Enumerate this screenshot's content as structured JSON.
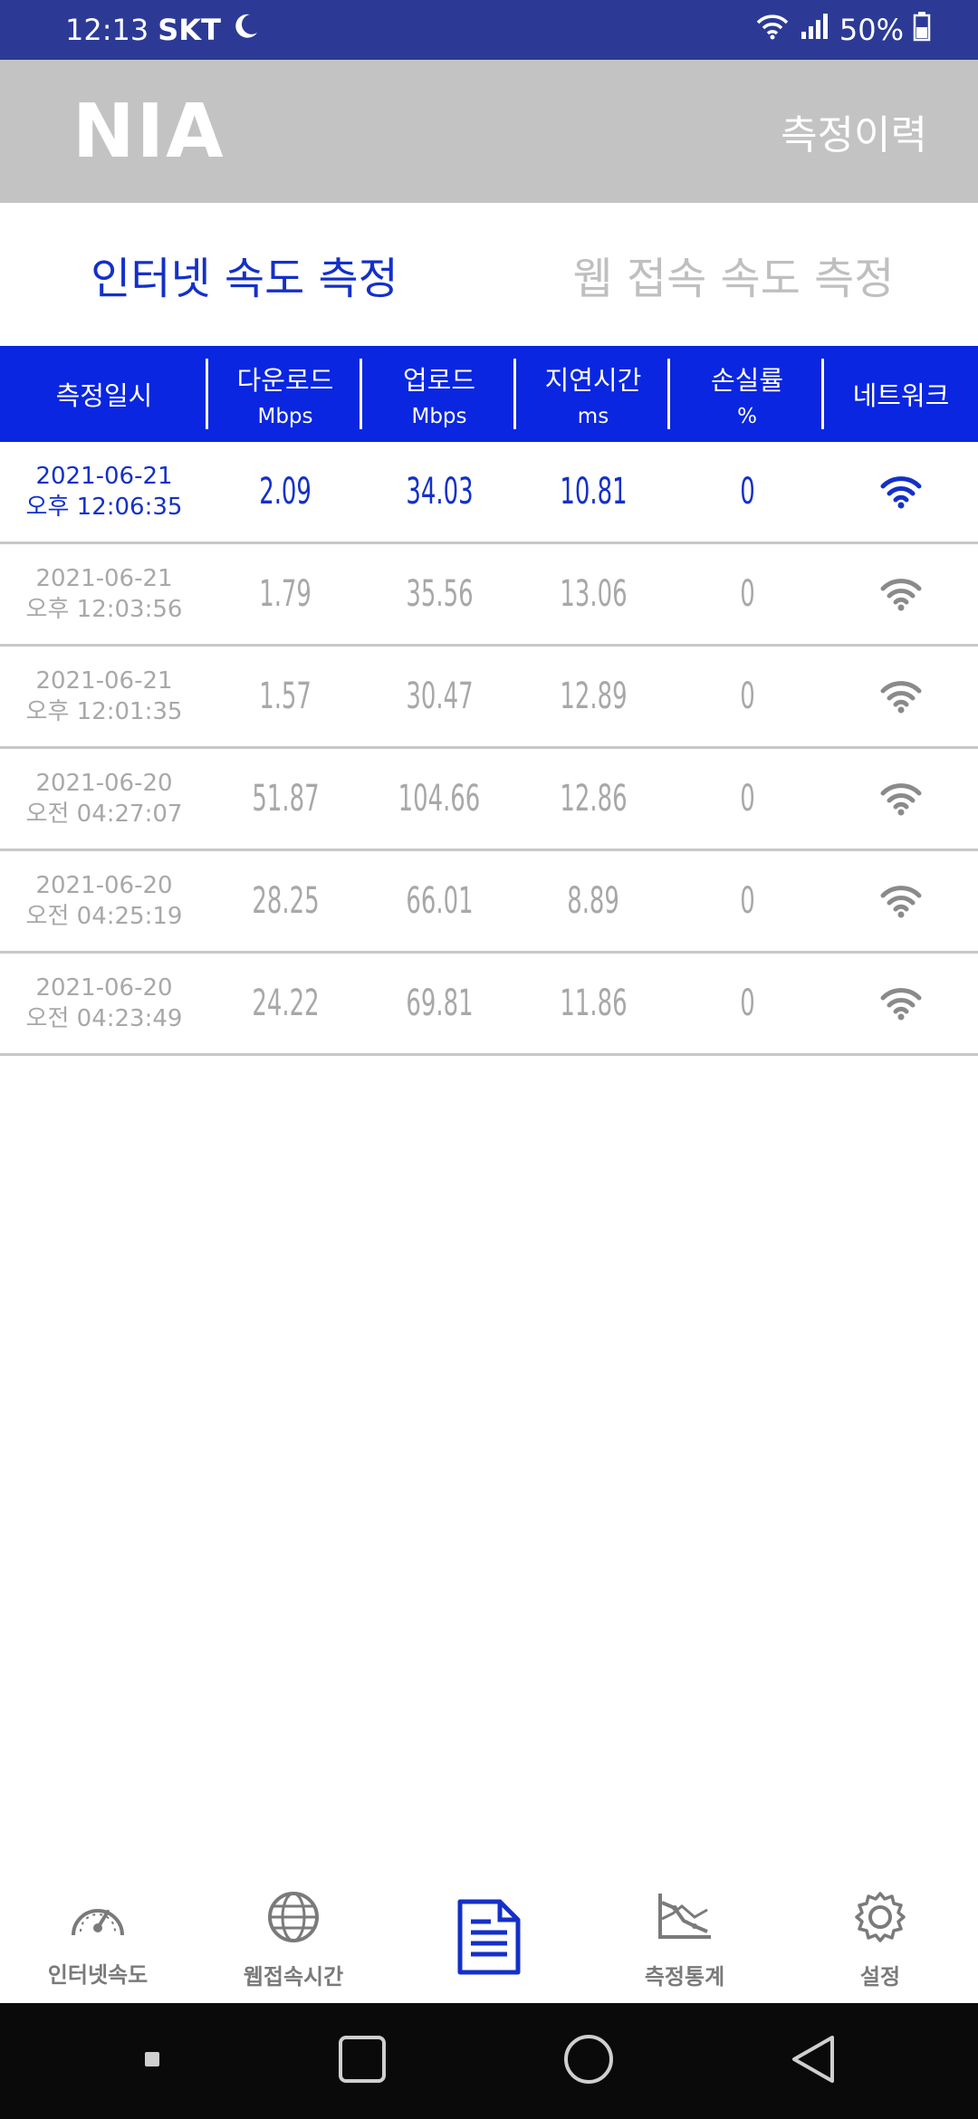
{
  "status": {
    "time": "12:13",
    "carrier": "SKT",
    "battery": "50%"
  },
  "header": {
    "logo": "NIA",
    "history_label": "측정이력"
  },
  "tabs": [
    {
      "label": "인터넷 속도 측정",
      "active": true
    },
    {
      "label": "웹 접속 속도 측정",
      "active": false
    }
  ],
  "table": {
    "columns": [
      {
        "title": "측정일시",
        "unit": ""
      },
      {
        "title": "다운로드",
        "unit": "Mbps"
      },
      {
        "title": "업로드",
        "unit": "Mbps"
      },
      {
        "title": "지연시간",
        "unit": "ms"
      },
      {
        "title": "손실률",
        "unit": "%"
      },
      {
        "title": "네트워크",
        "unit": ""
      }
    ],
    "rows": [
      {
        "date": "2021-06-21",
        "time": "오후 12:06:35",
        "download": "2.09",
        "upload": "34.03",
        "latency": "10.81",
        "loss": "0",
        "network": "wifi-icon"
      },
      {
        "date": "2021-06-21",
        "time": "오후 12:03:56",
        "download": "1.79",
        "upload": "35.56",
        "latency": "13.06",
        "loss": "0",
        "network": "wifi-icon"
      },
      {
        "date": "2021-06-21",
        "time": "오후 12:01:35",
        "download": "1.57",
        "upload": "30.47",
        "latency": "12.89",
        "loss": "0",
        "network": "wifi-icon"
      },
      {
        "date": "2021-06-20",
        "time": "오전 04:27:07",
        "download": "51.87",
        "upload": "104.66",
        "latency": "12.86",
        "loss": "0",
        "network": "wifi-icon"
      },
      {
        "date": "2021-06-20",
        "time": "오전 04:25:19",
        "download": "28.25",
        "upload": "66.01",
        "latency": "8.89",
        "loss": "0",
        "network": "wifi-icon"
      },
      {
        "date": "2021-06-20",
        "time": "오전 04:23:49",
        "download": "24.22",
        "upload": "69.81",
        "latency": "11.86",
        "loss": "0",
        "network": "wifi-icon"
      }
    ]
  },
  "bottom_nav": [
    {
      "label": "인터넷속도",
      "icon": "speedometer-icon"
    },
    {
      "label": "웹접속시간",
      "icon": "globe-icon"
    },
    {
      "label": "",
      "icon": "document-icon",
      "active": true
    },
    {
      "label": "측정통계",
      "icon": "chart-icon"
    },
    {
      "label": "설정",
      "icon": "gear-icon"
    }
  ],
  "colors": {
    "status_bar": "#2c3a96",
    "header": "#c3c3c3",
    "accent": "#1430c9",
    "table_header": "#0a26e0",
    "inactive": "#a8a8a8"
  }
}
